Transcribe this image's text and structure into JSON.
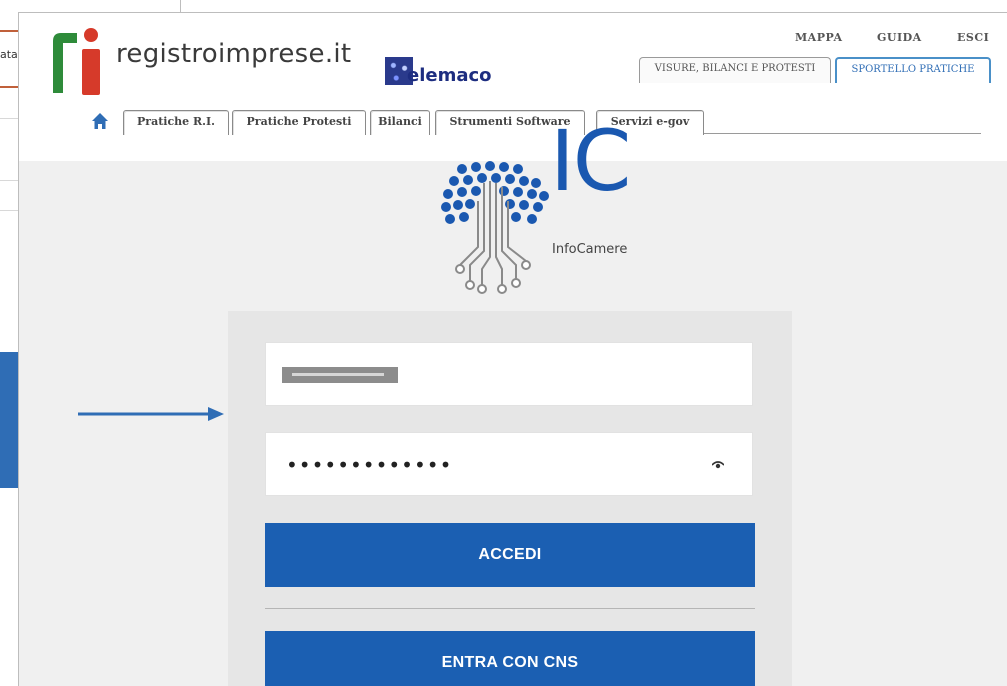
{
  "background_window": {
    "fragment_text": "ata"
  },
  "brand": {
    "site_name": "registroimprese.it",
    "telemaco_label": "elemaco"
  },
  "top_links": [
    {
      "label": "MAPPA"
    },
    {
      "label": "GUIDA"
    },
    {
      "label": "ESCI"
    }
  ],
  "portal_tabs": [
    {
      "label": "VISURE, BILANCI E PROTESTI",
      "active": false
    },
    {
      "label": "SPORTELLO PRATICHE",
      "active": true
    }
  ],
  "nav_tabs": [
    {
      "label": "Pratiche R.I."
    },
    {
      "label": "Pratiche Protesti"
    },
    {
      "label": "Bilanci"
    },
    {
      "label": "Strumenti Software"
    },
    {
      "label": "Servizi e-gov"
    }
  ],
  "infocamere": {
    "letters": "IC",
    "caption": "InfoCamere"
  },
  "login": {
    "password_mask": "•••••••••••••",
    "accedi_label": "ACCEDI",
    "cns_label": "ENTRA CON CNS"
  },
  "colors": {
    "primary_blue": "#1b5fb2",
    "accent_blue": "#2f6db5",
    "tab_border_active": "#4a90c8",
    "logo_green": "#2e8b3a",
    "logo_red": "#d63a2a"
  },
  "icons": [
    "home-icon",
    "eye-icon",
    "arrow-right-icon",
    "tree-logo-icon"
  ]
}
